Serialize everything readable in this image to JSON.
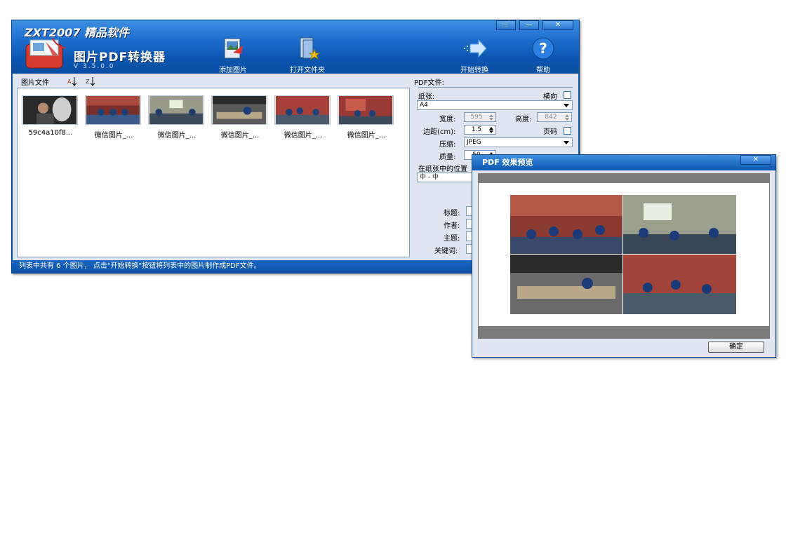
{
  "app": {
    "brand": "ZXT2007 精品软件",
    "title": "图片PDF转换器",
    "version": "V 3.5.0.0"
  },
  "toolbar": {
    "add_images": "添加图片",
    "open_folder": "打开文件夹",
    "start_convert": "开始转换",
    "help": "帮助"
  },
  "file_list": {
    "header": "图片文件",
    "items": [
      {
        "name": "59c4a10f8..."
      },
      {
        "name": "微信图片_..."
      },
      {
        "name": "微信图片_..."
      },
      {
        "name": "微信图片_..."
      },
      {
        "name": "微信图片_..."
      },
      {
        "name": "微信图片_..."
      }
    ]
  },
  "pdf_settings": {
    "section": "PDF文件:",
    "paper_label": "纸张:",
    "paper_value": "A4",
    "landscape_label": "横向",
    "width_label": "宽度:",
    "width_value": "595",
    "height_label": "高度:",
    "height_value": "842",
    "margin_label": "边距(cm):",
    "margin_value": "1.5",
    "page_num_label": "页码",
    "compress_label": "压缩:",
    "compress_value": "JPEG",
    "quality_label": "质量:",
    "quality_value": "50",
    "position_label": "在纸张中的位置",
    "position_value": "中 - 中",
    "title_label": "标题:",
    "author_label": "作者:",
    "subject_label": "主题:",
    "keywords_label": "关键词:"
  },
  "status": "列表中共有 6 个图片， 点击\"开始转换\"按钮将列表中的图片制作成PDF文件。",
  "preview": {
    "title": "PDF 效果预览",
    "ok": "确定"
  }
}
